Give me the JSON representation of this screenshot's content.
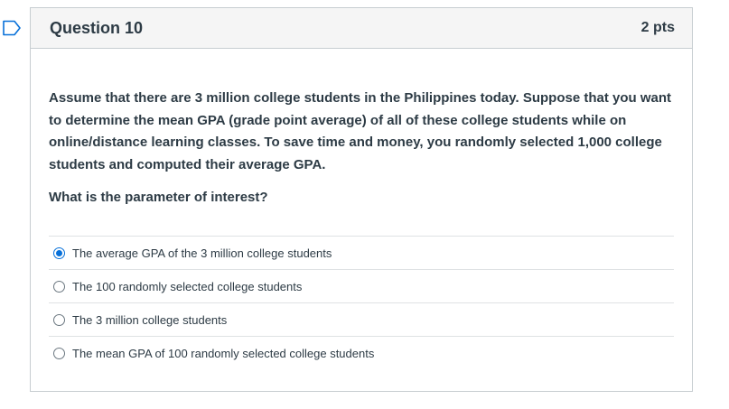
{
  "question": {
    "title": "Question 10",
    "points": "2 pts",
    "text": "Assume that there are 3 million college students in the Philippines today. Suppose that you want to determine the mean GPA (grade point average) of all of these college students while on online/distance learning classes. To save time and money, you randomly selected 1,000 college students and computed their average GPA.",
    "prompt": "What is the parameter of interest?",
    "flag_icon": "flag-outline-icon",
    "accent_color": "#0770d9"
  },
  "answers": [
    {
      "label": "The average GPA of the 3 million college students",
      "selected": true
    },
    {
      "label": "The 100 randomly selected college students",
      "selected": false
    },
    {
      "label": "The 3 million college students",
      "selected": false
    },
    {
      "label": "The mean GPA of 100 randomly selected college students",
      "selected": false
    }
  ]
}
